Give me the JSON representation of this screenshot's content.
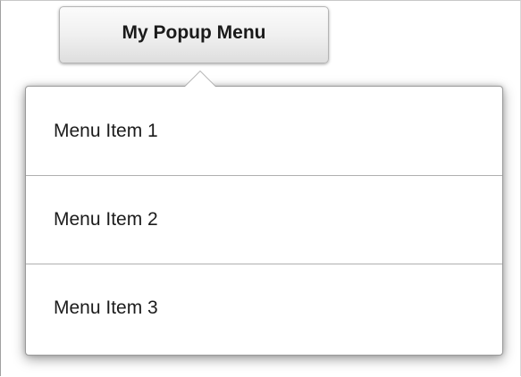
{
  "button": {
    "label": "My Popup Menu"
  },
  "menu": {
    "items": [
      {
        "label": "Menu Item 1"
      },
      {
        "label": "Menu Item 2"
      },
      {
        "label": "Menu Item 3"
      }
    ]
  },
  "colors": {
    "background": "#ffffff",
    "button_top": "#fbfbfb",
    "button_bottom": "#dedede",
    "menu_border": "#9a9a9a",
    "divider": "#b0b0b0",
    "text": "#1c1c1c"
  }
}
